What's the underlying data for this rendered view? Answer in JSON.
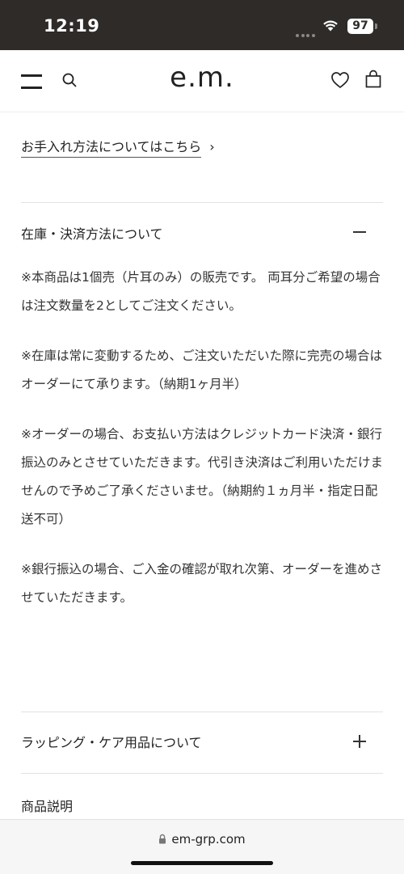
{
  "status_bar": {
    "time": "12:19",
    "battery": "97"
  },
  "header": {
    "logo": "e.m."
  },
  "care_link": {
    "label": "お手入れ方法についてはこちら",
    "chevron": "›"
  },
  "accordions": [
    {
      "title": "在庫・決済方法について",
      "state": "expanded",
      "paragraphs": [
        "※本商品は1個売（片耳のみ）の販売です。 両耳分ご希望の場合は注文数量を2としてご注文ください。",
        "※在庫は常に変動するため、ご注文いただいた際に完売の場合はオーダーにて承ります。（納期1ヶ月半）",
        "※オーダーの場合、お支払い方法はクレジットカード決済・銀行振込のみとさせていただきます。代引き決済はご利用いただけませんので予めご了承くださいませ。（納期約１ヵ月半・指定日配送不可）",
        "※銀行振込の場合、ご入金の確認が取れ次第、オーダーを進めさせていただきます。"
      ]
    },
    {
      "title": "ラッピング・ケア用品について",
      "state": "collapsed"
    },
    {
      "title": "商品説明"
    }
  ],
  "browser": {
    "url": "em-grp.com"
  },
  "colors": {
    "status_bar_bg": "#2e2b29",
    "text": "#222222",
    "divider": "#e4e2e0",
    "bottom_bar_bg": "#f6f6f6"
  }
}
